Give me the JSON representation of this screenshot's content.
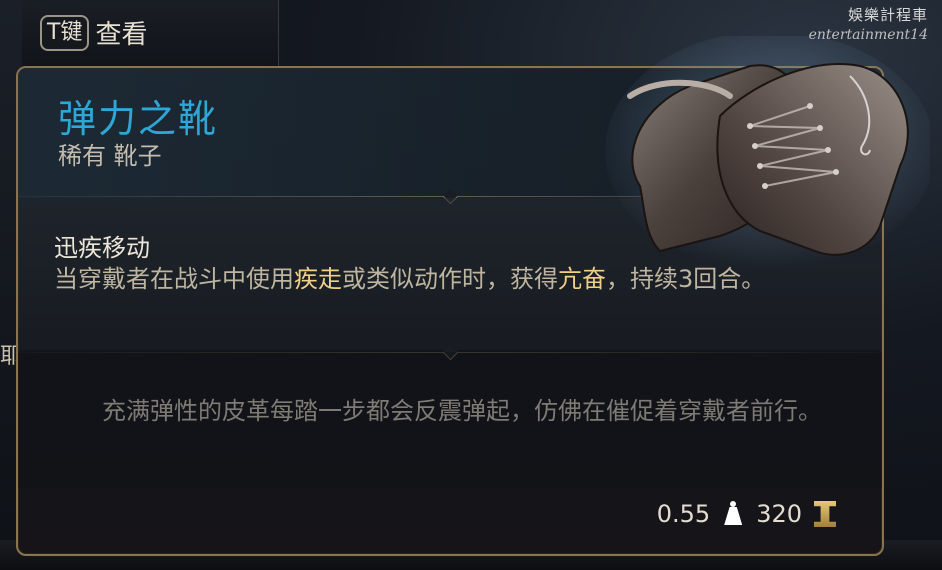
{
  "hud": {
    "key": "T键",
    "key_label": "查看",
    "edge_char": "耶"
  },
  "watermark": {
    "chinese": "娛樂計程車",
    "english": "entertainment14"
  },
  "item": {
    "name": "弹力之靴",
    "rarity_type": "稀有 靴子",
    "name_color": "#2ea6d6",
    "icon": "leather-boots-icon"
  },
  "passive": {
    "title": "迅疾移动",
    "desc_part1": "当穿戴者在战斗中使用",
    "desc_hl1": "疾走",
    "desc_part2": "或类似动作时，获得",
    "desc_hl2": "亢奋",
    "desc_part3": "，持续3回合。",
    "highlight_color": "#f0d089"
  },
  "flavor_text": "充满弹性的皮革每踏一步都会反震弹起，仿佛在催促着穿戴者前行。",
  "footer": {
    "weight": "0.55",
    "weight_icon": "weight-icon",
    "value": "320",
    "value_icon": "gold-coin-icon"
  }
}
